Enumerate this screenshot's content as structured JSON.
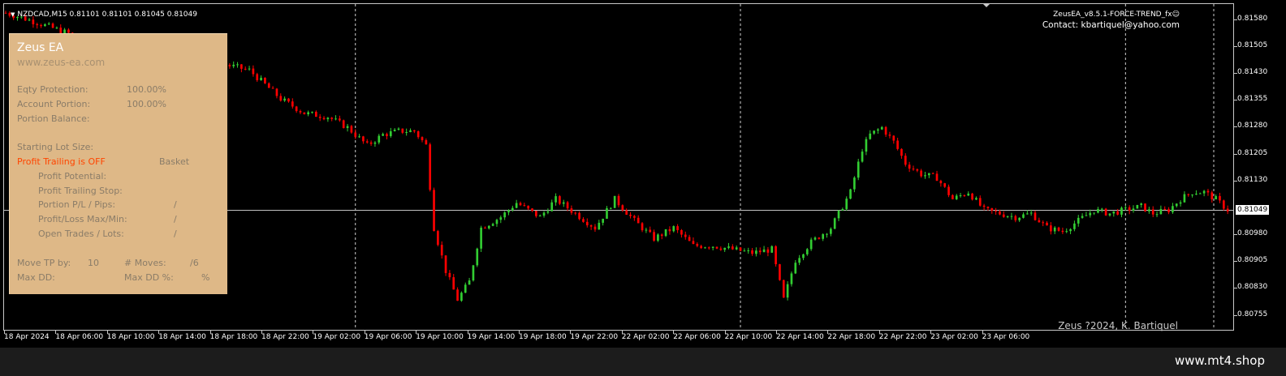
{
  "symbol_header": "NZDCAD,M15  0.81101 0.81101 0.81045 0.81049",
  "ea": {
    "title": "ZeusEA_v8.5.1-FORCE-TREND_fx☺",
    "contact": "Contact: kbartiquel@yahoo.com",
    "copyright": "Zeus ?2024, K. Bartiquel"
  },
  "panel": {
    "title": "Zeus EA",
    "site": "www.zeus-ea.com",
    "eqty_protection_label": "Eqty Protection:",
    "eqty_protection_value": "100.00%",
    "account_portion_label": "Account Portion:",
    "account_portion_value": "100.00%",
    "portion_balance_label": "Portion Balance:",
    "starting_lot_label": "Starting Lot Size:",
    "profit_trailing_label": "Profit Trailing is OFF",
    "basket_label": "Basket",
    "profit_potential_label": "Profit Potential:",
    "profit_trailing_stop_label": "Profit Trailing Stop:",
    "portion_pl_label": "Portion P/L / Pips:",
    "portion_pl_value": "/",
    "profit_loss_label": "Profit/Loss Max/Min:",
    "profit_loss_value": "/",
    "open_trades_label": "Open Trades / Lots:",
    "open_trades_value": "/",
    "move_tp_label": "Move TP by:",
    "move_tp_value": "10",
    "moves_label": "# Moves:",
    "moves_value": "/6",
    "max_dd_label": "Max DD:",
    "max_dd_pct_label": "Max DD %:",
    "max_dd_pct_value": "%"
  },
  "price_axis": {
    "labels": [
      "0.81580",
      "0.81505",
      "0.81430",
      "0.81355",
      "0.81280",
      "0.81205",
      "0.81130",
      "0.80980",
      "0.80905",
      "0.80830",
      "0.80755"
    ],
    "current_price": "0.81049"
  },
  "time_axis": {
    "labels": [
      "18 Apr 2024",
      "18 Apr 06:00",
      "18 Apr 10:00",
      "18 Apr 14:00",
      "18 Apr 18:00",
      "18 Apr 22:00",
      "19 Apr 02:00",
      "19 Apr 06:00",
      "19 Apr 10:00",
      "19 Apr 14:00",
      "19 Apr 18:00",
      "19 Apr 22:00",
      "22 Apr 02:00",
      "22 Apr 06:00",
      "22 Apr 10:00",
      "22 Apr 14:00",
      "22 Apr 18:00",
      "22 Apr 22:00",
      "23 Apr 02:00",
      "23 Apr 06:00"
    ]
  },
  "footer": {
    "text": "www.mt4.shop"
  },
  "colors": {
    "bull": "#32CD32",
    "bear": "#FF0000",
    "background": "#000000",
    "panel": "#DEB887",
    "warning": "#FF4500"
  },
  "chart_data": {
    "type": "candlestick",
    "ylim": [
      0.8072,
      0.8162
    ],
    "x_index_range": [
      0,
      312
    ],
    "day_separators_at_index": [
      89,
      187,
      285
    ],
    "current_price": 0.81049,
    "close_path": [
      [
        0,
        0.816
      ],
      [
        6,
        0.8158
      ],
      [
        14,
        0.8155
      ],
      [
        22,
        0.8152
      ],
      [
        30,
        0.815
      ],
      [
        38,
        0.8148
      ],
      [
        46,
        0.8147
      ],
      [
        54,
        0.8146
      ],
      [
        62,
        0.8144
      ],
      [
        70,
        0.8136
      ],
      [
        76,
        0.8132
      ],
      [
        82,
        0.8131
      ],
      [
        87,
        0.8128
      ],
      [
        92,
        0.8123
      ],
      [
        96,
        0.8126
      ],
      [
        100,
        0.8127
      ],
      [
        104,
        0.8127
      ],
      [
        107,
        0.8123
      ],
      [
        109,
        0.81
      ],
      [
        112,
        0.8088
      ],
      [
        115,
        0.808
      ],
      [
        118,
        0.8085
      ],
      [
        121,
        0.81
      ],
      [
        126,
        0.8103
      ],
      [
        130,
        0.8107
      ],
      [
        136,
        0.8103
      ],
      [
        140,
        0.8108
      ],
      [
        145,
        0.8104
      ],
      [
        150,
        0.81
      ],
      [
        155,
        0.8108
      ],
      [
        160,
        0.8102
      ],
      [
        165,
        0.8097
      ],
      [
        170,
        0.81
      ],
      [
        175,
        0.8095
      ],
      [
        180,
        0.8095
      ],
      [
        185,
        0.8094
      ],
      [
        190,
        0.8093
      ],
      [
        195,
        0.8094
      ],
      [
        198,
        0.808
      ],
      [
        201,
        0.8091
      ],
      [
        205,
        0.8096
      ],
      [
        210,
        0.81
      ],
      [
        215,
        0.811
      ],
      [
        218,
        0.8122
      ],
      [
        220,
        0.8126
      ],
      [
        223,
        0.8128
      ],
      [
        226,
        0.8124
      ],
      [
        229,
        0.8118
      ],
      [
        233,
        0.8115
      ],
      [
        237,
        0.8114
      ],
      [
        241,
        0.8108
      ],
      [
        245,
        0.811
      ],
      [
        249,
        0.8105
      ],
      [
        253,
        0.8104
      ],
      [
        257,
        0.8103
      ],
      [
        261,
        0.8104
      ],
      [
        265,
        0.81
      ],
      [
        269,
        0.8099
      ],
      [
        273,
        0.8102
      ],
      [
        277,
        0.8105
      ],
      [
        281,
        0.8104
      ],
      [
        285,
        0.8105
      ],
      [
        289,
        0.8106
      ],
      [
        292,
        0.8104
      ],
      [
        296,
        0.8105
      ],
      [
        299,
        0.8108
      ],
      [
        302,
        0.811
      ],
      [
        305,
        0.811
      ],
      [
        308,
        0.8108
      ],
      [
        311,
        0.8105
      ]
    ]
  }
}
